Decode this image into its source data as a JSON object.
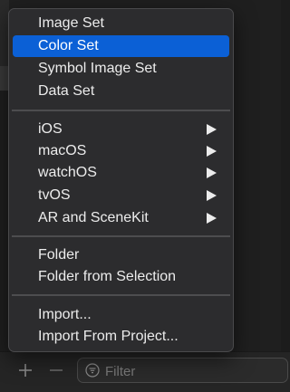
{
  "menu": {
    "groups": [
      {
        "items": [
          {
            "label": "Image Set",
            "selected": false
          },
          {
            "label": "Color Set",
            "selected": true
          },
          {
            "label": "Symbol Image Set",
            "selected": false
          },
          {
            "label": "Data Set",
            "selected": false
          }
        ]
      },
      {
        "items": [
          {
            "label": "iOS",
            "has_submenu": true
          },
          {
            "label": "macOS",
            "has_submenu": true
          },
          {
            "label": "watchOS",
            "has_submenu": true
          },
          {
            "label": "tvOS",
            "has_submenu": true
          },
          {
            "label": "AR and SceneKit",
            "has_submenu": true
          }
        ]
      },
      {
        "items": [
          {
            "label": "Folder"
          },
          {
            "label": "Folder from Selection"
          }
        ]
      },
      {
        "items": [
          {
            "label": "Import..."
          },
          {
            "label": "Import From Project..."
          }
        ]
      }
    ],
    "selection_color": "#0b60d6"
  },
  "toolbar": {
    "add_icon": "plus-icon",
    "remove_icon": "minus-icon",
    "filter_placeholder": "Filter",
    "filter_value": ""
  }
}
